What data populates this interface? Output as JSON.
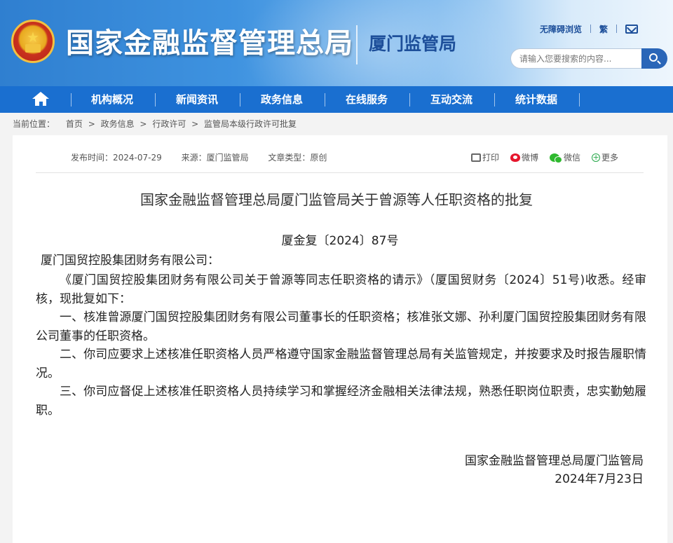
{
  "header": {
    "site_title": "国家金融监督管理总局",
    "sub_title": "厦门监管局",
    "tools": {
      "accessibility": "无障碍浏览",
      "traditional": "繁",
      "mail_icon": "mail-icon"
    },
    "search": {
      "placeholder": "请输入您要搜索的内容..."
    }
  },
  "nav": {
    "home_icon": "home-icon",
    "items": [
      {
        "label": "机构概况"
      },
      {
        "label": "新闻资讯"
      },
      {
        "label": "政务信息"
      },
      {
        "label": "在线服务"
      },
      {
        "label": "互动交流"
      },
      {
        "label": "统计数据"
      }
    ]
  },
  "breadcrumb": {
    "prefix": "当前位置：",
    "items": [
      "首页",
      "政务信息",
      "行政许可",
      "监管局本级行政许可批复"
    ],
    "separator": ">"
  },
  "article": {
    "meta": {
      "publish": "发布时间：2024-07-29",
      "source": "来源：厦门监管局",
      "type": "文章类型：原创"
    },
    "share": {
      "print": "打印",
      "weibo": "微博",
      "wechat": "微信",
      "more": "更多"
    },
    "title": "国家金融监督管理总局厦门监管局关于曾源等人任职资格的批复",
    "doc_no": "厦金复〔2024〕87号",
    "addressee": "厦门国贸控股集团财务有限公司：",
    "paragraphs": [
      "《厦门国贸控股集团财务有限公司关于曾源等同志任职资格的请示》（厦国贸财务〔2024〕51号)收悉。经审核，现批复如下：",
      "一、核准曾源厦门国贸控股集团财务有限公司董事长的任职资格；核准张文娜、孙利厦门国贸控股集团财务有限公司董事的任职资格。",
      "二、你司应要求上述核准任职资格人员严格遵守国家金融监督管理总局有关监管规定，并按要求及时报告履职情况。",
      "三、你司应督促上述核准任职资格人员持续学习和掌握经济金融相关法律法规，熟悉任职岗位职责，忠实勤勉履职。"
    ],
    "signature": "国家金融监督管理总局厦门监管局",
    "date": "2024年7月23日"
  },
  "colors": {
    "nav_bg": "#1a6fd0",
    "title_blue": "#1d4f9a",
    "search_btn": "#2a66b8"
  }
}
